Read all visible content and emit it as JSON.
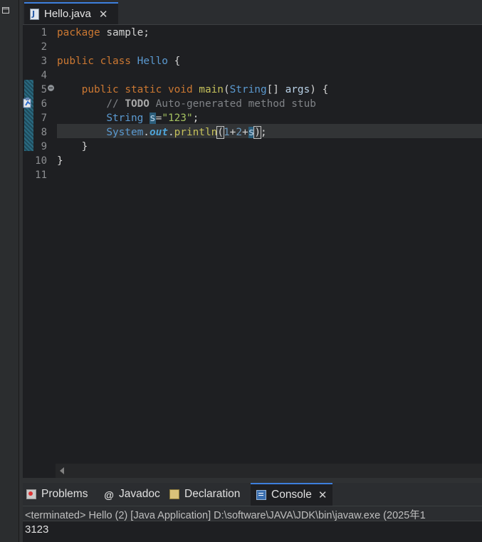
{
  "window": {
    "restore_icon": "restore-icon"
  },
  "editor": {
    "tab": {
      "label": "Hello.java",
      "icon": "java-file-icon",
      "icon_letter": "J",
      "close": "✕"
    },
    "line_numbers": [
      "1",
      "2",
      "3",
      "4",
      "5",
      "6",
      "7",
      "8",
      "9",
      "10",
      "11"
    ],
    "lines": {
      "l1": {
        "kw": "package",
        "rest": " sample;"
      },
      "l3": {
        "kw1": "public",
        "kw2": "class",
        "name": "Hello",
        "brace": " {"
      },
      "l5": {
        "kw1": "public",
        "kw2": "static",
        "kw3": "void",
        "method": "main",
        "open": "(",
        "type": "String",
        "arr": "[] ",
        "param": "args",
        "close": ") {"
      },
      "l6": {
        "comment_start": "// ",
        "todo": "TODO",
        "comment_rest": " Auto-generated method stub"
      },
      "l7": {
        "type": "String",
        "var": "s",
        "eq": "=",
        "str": "\"123\"",
        "end": ";"
      },
      "l8": {
        "cls": "System",
        "dot1": ".",
        "field": "out",
        "dot2": ".",
        "method": "println",
        "open": "(",
        "n1": "1",
        "plus1": "+",
        "n2": "2",
        "plus2": "+",
        "var": "s",
        "close": ")",
        "end": ";"
      },
      "l9": {
        "text": "}"
      },
      "l10": {
        "text": "}"
      }
    }
  },
  "console": {
    "tabs": [
      {
        "label": "Problems",
        "icon": "problems-icon"
      },
      {
        "label": "Javadoc",
        "icon": "at-icon",
        "glyph": "@"
      },
      {
        "label": "Declaration",
        "icon": "declaration-icon"
      },
      {
        "label": "Console",
        "icon": "console-icon",
        "close": "✕"
      }
    ],
    "status": "<terminated> Hello (2) [Java Application] D:\\software\\JAVA\\JDK\\bin\\javaw.exe  (2025年1",
    "output": "3123"
  }
}
